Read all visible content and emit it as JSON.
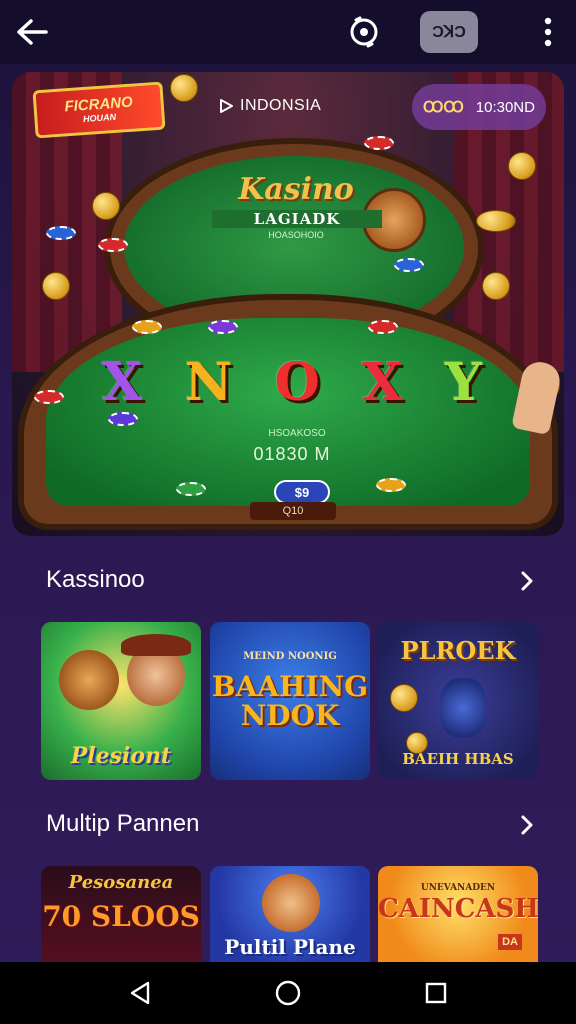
{
  "topbar": {
    "back_icon": "arrow-left-icon",
    "camera_icon": "camera-rotate-icon",
    "badge_label": "ƆꓘƆ",
    "more_icon": "more-vertical-icon"
  },
  "hero": {
    "brand_title": "FICRANO",
    "brand_sub": "HOUAN",
    "region_label": "INDONSIA",
    "pill_icon_text": "ꝎꝎ",
    "pill_label": "10:30ND",
    "table_title": "Kasino",
    "table_subtitle": "LAGIADK",
    "table_code": "HOASOHOIO",
    "letters": [
      "X",
      "N",
      "O",
      "X",
      "Y"
    ],
    "bet_label": "HSOAKOSO",
    "bet_value": "01830 M",
    "chip_label": "$9",
    "bottom_code": "Q10"
  },
  "sections": [
    {
      "title": "Kassinoo",
      "tiles": [
        {
          "title": "Plesiont"
        },
        {
          "title": "BAAHING NDOK",
          "top_text": "MEIND NOONIG"
        },
        {
          "title": "PLROEK",
          "bottom_text": "BAEIH HBAS"
        }
      ]
    },
    {
      "title": "Multip Pannen",
      "tiles": [
        {
          "title": "Pesosanea",
          "sub": "70 SLOOS"
        },
        {
          "title": "Pultil Plane"
        },
        {
          "title": "CAINCASH",
          "top_text": "UNEVANADEN",
          "badge": "DA"
        }
      ]
    }
  ],
  "navbar": {
    "back_icon": "triangle-back-icon",
    "home_icon": "circle-home-icon",
    "recents_icon": "square-recents-icon"
  },
  "colors": {
    "background": "#2a1850",
    "topbar": "#150d2c",
    "accent_gold": "#f3c24a",
    "felt_green": "#2faa4a"
  }
}
